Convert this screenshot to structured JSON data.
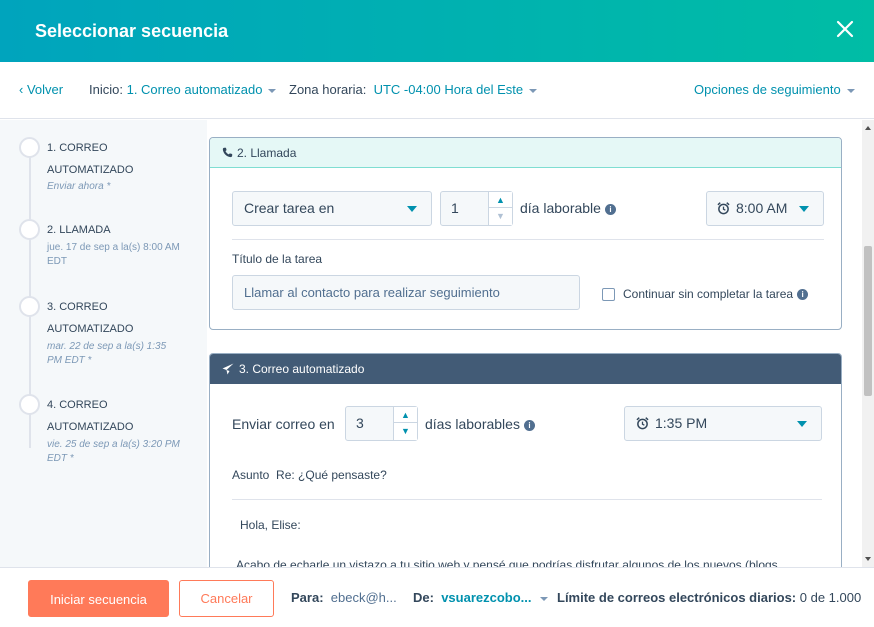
{
  "header": {
    "title": "Seleccionar secuencia"
  },
  "toolbar": {
    "back_label": "‹ Volver",
    "start_label": "Inicio:",
    "start_value": "1. Correo automatizado",
    "timezone_label": "Zona horaria:",
    "timezone_value": "UTC -04:00 Hora del Este",
    "options_label": "Opciones de seguimiento"
  },
  "steps": [
    {
      "name_line1": "1. CORREO",
      "name_line2": "AUTOMATIZADO",
      "sub": "Enviar ahora *"
    },
    {
      "name_line1": "2. LLAMADA",
      "sub_line1": "jue. 17 de sep a la(s) 8:00 AM",
      "sub_line2": "EDT"
    },
    {
      "name_line1": "3. CORREO",
      "name_line2": "AUTOMATIZADO",
      "sub_line1": "mar. 22 de sep a la(s) 1:35",
      "sub_line2": "PM EDT *"
    },
    {
      "name_line1": "4. CORREO",
      "name_line2": "AUTOMATIZADO",
      "sub_line1": "vie. 25 de sep a la(s) 3:20 PM",
      "sub_line2": "EDT *"
    }
  ],
  "call_card": {
    "header": "2. Llamada",
    "action_select": "Crear tarea en",
    "delay_value": "1",
    "delay_unit": "día laborable",
    "time_value": "8:00 AM",
    "task_title_label": "Título de la tarea",
    "task_title_value": "Llamar al contacto para realizar seguimiento",
    "continue_label": "Continuar sin completar la tarea"
  },
  "email_card": {
    "header": "3. Correo automatizado",
    "send_label": "Enviar correo en",
    "delay_value": "3",
    "delay_unit": "días laborables",
    "time_value": "1:35 PM",
    "subject_label": "Asunto",
    "subject_value": "Re: ¿Qué pensaste?",
    "body_greeting": "Hola, Elise:",
    "body_text": "Acabo de echarle un vistazo a tu sitio web y pensé que podrías disfrutar algunos de los nuevos (blogs"
  },
  "footer": {
    "start_button": "Iniciar secuencia",
    "cancel_button": "Cancelar",
    "to_label": "Para:",
    "to_value": "ebeck@h...",
    "from_label": "De:",
    "from_value": "vsuarezcobo...",
    "limit_label": "Límite de correos electrónicos diarios:",
    "limit_value": "0 de 1.000"
  },
  "colors": {
    "header_gradient_start": "#00a4bd",
    "header_gradient_end": "#00bda5",
    "link": "#0091ae",
    "primary_button": "#ff7a59",
    "email_card_header": "#425b76"
  },
  "icons": [
    "close-icon",
    "phone-icon",
    "paper-plane-icon",
    "alarm-clock-icon",
    "info-icon",
    "chevron-up-icon",
    "chevron-down-icon"
  ]
}
